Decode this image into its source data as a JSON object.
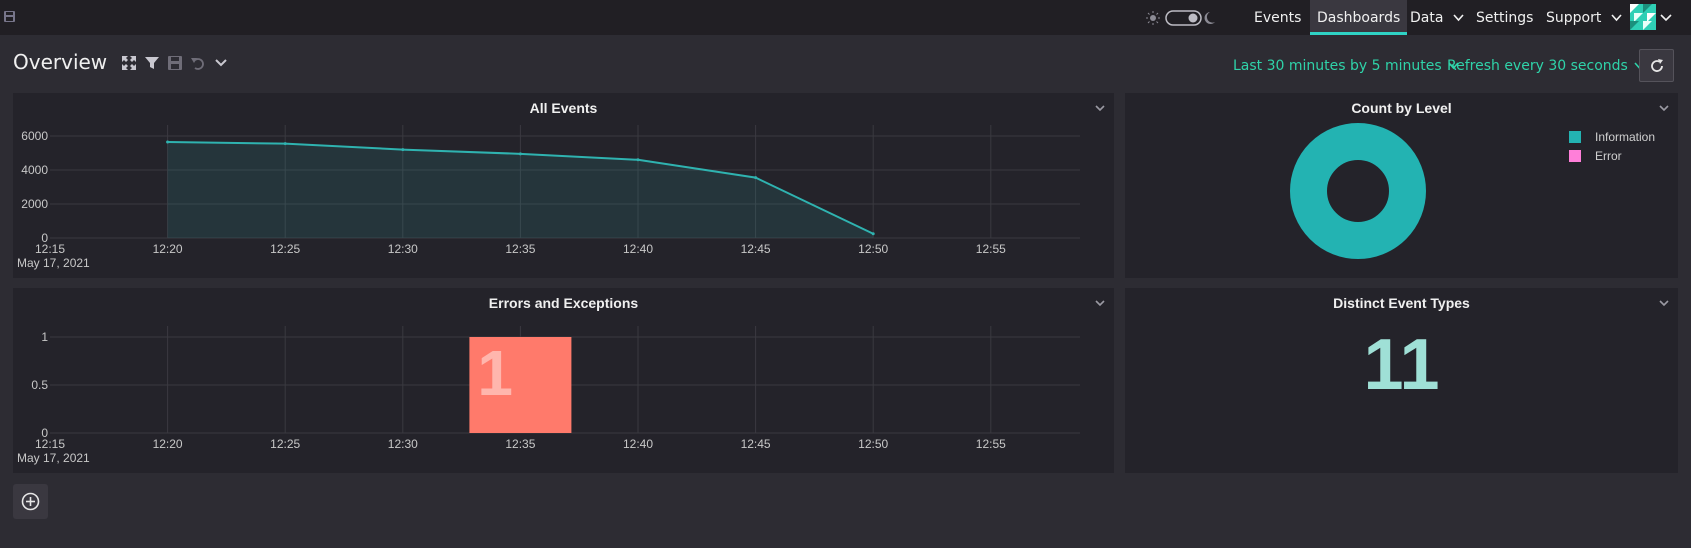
{
  "nav": {
    "items": [
      {
        "label": "Events",
        "active": false
      },
      {
        "label": "Dashboards",
        "active": true
      },
      {
        "label": "Data",
        "has_menu": true
      },
      {
        "label": "Settings",
        "active": false
      },
      {
        "label": "Support",
        "has_menu": true
      }
    ],
    "accent_color": "#2fd3c5"
  },
  "toolbar": {
    "title": "Overview",
    "time_range": "Last 30 minutes by 5 minutes",
    "refresh": "Refresh every 30 seconds",
    "icons": [
      "expand-icon",
      "filter-icon",
      "save-icon",
      "undo-icon",
      "chevron-down-icon",
      "refresh-icon"
    ]
  },
  "panels": {
    "all_events": {
      "title": "All Events"
    },
    "count_by_level": {
      "title": "Count by Level"
    },
    "errors": {
      "title": "Errors and Exceptions"
    },
    "distinct": {
      "title": "Distinct Event Types",
      "value": "11",
      "color": "#9fe0d6"
    }
  },
  "date_label": "May 17, 2021",
  "chart_data": [
    {
      "type": "area",
      "title": "All Events",
      "x_ticks": [
        "12:15",
        "12:20",
        "12:25",
        "12:30",
        "12:35",
        "12:40",
        "12:45",
        "12:50",
        "12:55"
      ],
      "y_ticks": [
        "0",
        "2000",
        "4000",
        "6000"
      ],
      "ylim": [
        0,
        6000
      ],
      "x": [
        "12:20",
        "12:25",
        "12:30",
        "12:35",
        "12:40",
        "12:45",
        "12:50"
      ],
      "values": [
        5650,
        5550,
        5200,
        4950,
        4600,
        3550,
        250
      ],
      "color": "#2fb3b0",
      "grid": true
    },
    {
      "type": "pie",
      "title": "Count by Level",
      "donut": true,
      "legend_position": "top-right",
      "series": [
        {
          "name": "Information",
          "value": 100,
          "color": "#23b3b2"
        },
        {
          "name": "Error",
          "value": 0,
          "color": "#ff7fd9"
        }
      ]
    },
    {
      "type": "bar",
      "title": "Errors and Exceptions",
      "x_ticks": [
        "12:15",
        "12:20",
        "12:25",
        "12:30",
        "12:35",
        "12:40",
        "12:45",
        "12:50",
        "12:55"
      ],
      "y_ticks": [
        "0",
        "0.5",
        "1"
      ],
      "ylim": [
        0,
        1.0
      ],
      "categories": [
        "12:35"
      ],
      "values": [
        1
      ],
      "bar_label": "1",
      "color": "#ff7a6b",
      "grid": true
    }
  ]
}
